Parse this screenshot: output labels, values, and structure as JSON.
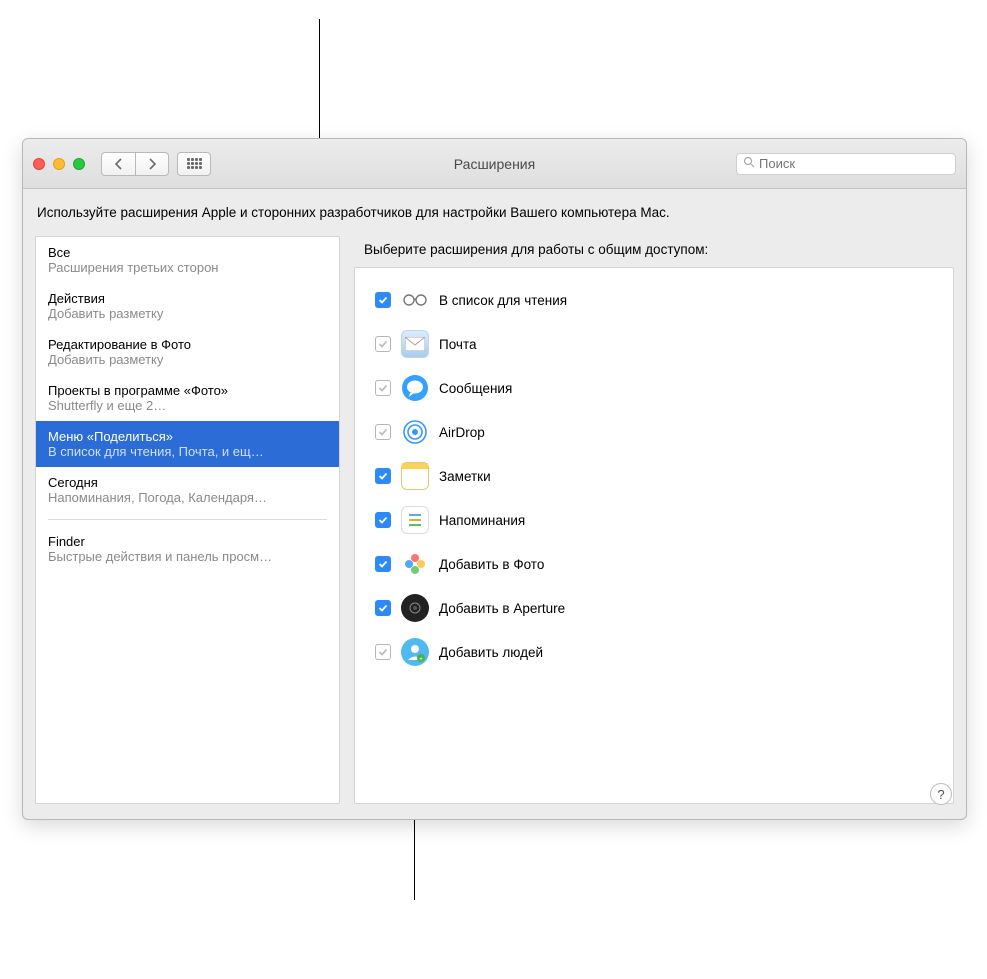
{
  "window": {
    "title": "Расширения",
    "search_placeholder": "Поиск",
    "description": "Используйте расширения Apple и сторонних разработчиков для настройки Вашего компьютера Mac."
  },
  "sidebar": {
    "items": [
      {
        "title": "Все",
        "subtitle": "Расширения третьих сторон"
      },
      {
        "title": "Действия",
        "subtitle": "Добавить разметку"
      },
      {
        "title": "Редактирование в Фото",
        "subtitle": "Добавить разметку"
      },
      {
        "title": "Проекты в программе «Фото»",
        "subtitle": "Shutterfly и еще 2…"
      },
      {
        "title": "Меню «Поделиться»",
        "subtitle": "В список для чтения, Почта, и ещ…",
        "selected": true
      },
      {
        "title": "Сегодня",
        "subtitle": "Напоминания, Погода, Календаря…"
      },
      {
        "divider": true
      },
      {
        "title": "Finder",
        "subtitle": "Быстрые действия и панель просм…"
      }
    ]
  },
  "main": {
    "header": "Выберите расширения для работы с общим доступом:",
    "extensions": [
      {
        "label": "В список для чтения",
        "checked": true,
        "icon": "glasses"
      },
      {
        "label": "Почта",
        "checked": false,
        "icon": "mail",
        "disabled": true
      },
      {
        "label": "Сообщения",
        "checked": false,
        "icon": "messages",
        "disabled": true
      },
      {
        "label": "AirDrop",
        "checked": false,
        "icon": "airdrop",
        "disabled": true
      },
      {
        "label": "Заметки",
        "checked": true,
        "icon": "notes"
      },
      {
        "label": "Напоминания",
        "checked": true,
        "icon": "reminders"
      },
      {
        "label": "Добавить в Фото",
        "checked": true,
        "icon": "photos"
      },
      {
        "label": "Добавить в Aperture",
        "checked": true,
        "icon": "aperture"
      },
      {
        "label": "Добавить людей",
        "checked": false,
        "icon": "people",
        "disabled": true
      }
    ]
  },
  "help_label": "?"
}
